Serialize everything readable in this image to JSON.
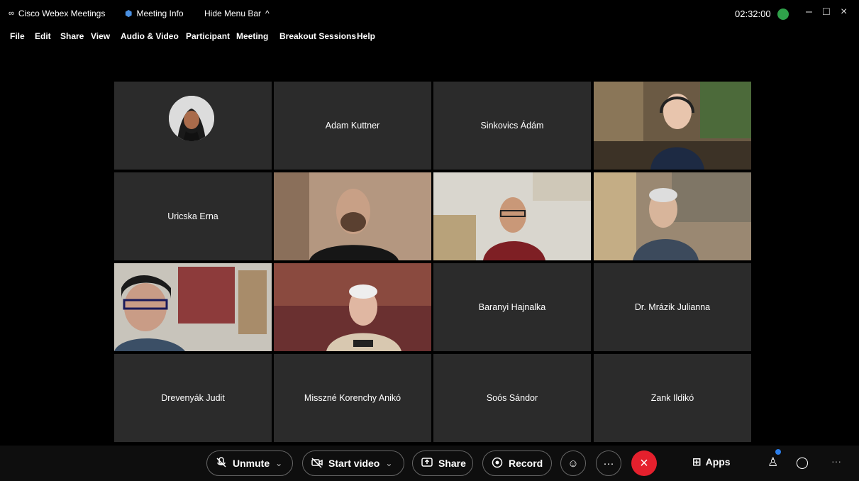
{
  "titlebar": {
    "app_title": "Cisco Webex Meetings",
    "meeting_info": "Meeting Info",
    "hide_menu": "Hide Menu Bar",
    "clock": "02:32:00"
  },
  "menu": [
    "File",
    "Edit",
    "Share",
    "View",
    "Audio & Video",
    "Participant",
    "Meeting",
    "Breakout Sessions",
    "Help"
  ],
  "tiles": [
    {
      "name": "",
      "type": "avatar"
    },
    {
      "name": "Adam Kuttner",
      "type": "name"
    },
    {
      "name": "Sinkovics Ádám",
      "type": "name"
    },
    {
      "name": "",
      "type": "video"
    },
    {
      "name": "Uricska Erna",
      "type": "name"
    },
    {
      "name": "",
      "type": "video"
    },
    {
      "name": "",
      "type": "video"
    },
    {
      "name": "",
      "type": "video"
    },
    {
      "name": "",
      "type": "video"
    },
    {
      "name": "",
      "type": "video"
    },
    {
      "name": "Baranyi Hajnalka",
      "type": "name"
    },
    {
      "name": "Dr. Mrázik Julianna",
      "type": "name"
    },
    {
      "name": "Drevenyák Judit",
      "type": "name"
    },
    {
      "name": "Misszné Korenchy Anikó",
      "type": "name"
    },
    {
      "name": "Soós Sándor",
      "type": "name"
    },
    {
      "name": "Zank Ildikó",
      "type": "name"
    }
  ],
  "controls": {
    "unmute": "Unmute",
    "start_video": "Start video",
    "share": "Share",
    "record": "Record",
    "apps": "Apps"
  },
  "colors": {
    "end_call": "#e5202d",
    "signal": "#2fa14a",
    "notification": "#2b7de9"
  }
}
